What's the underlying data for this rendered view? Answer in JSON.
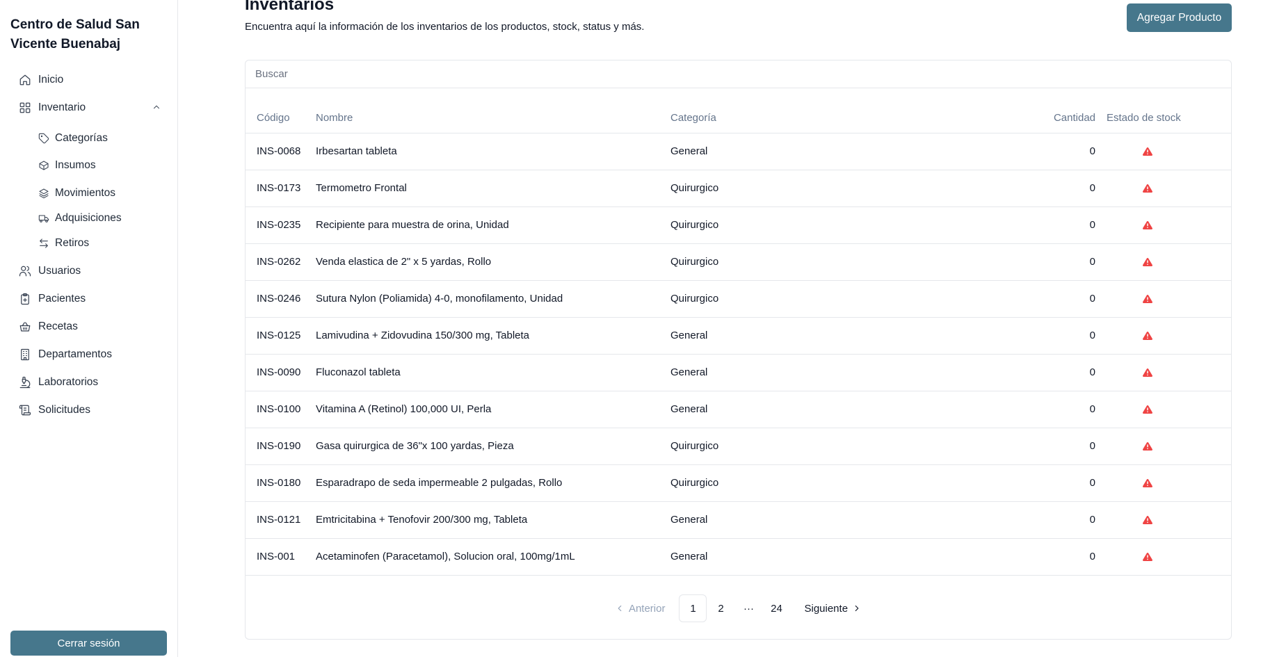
{
  "sidebar": {
    "brand": "Centro de Salud San Vicente Buenabaj",
    "items": [
      {
        "label": "Inicio",
        "icon": "home-icon"
      },
      {
        "label": "Inventario",
        "icon": "grid-icon"
      },
      {
        "label": "Categorías",
        "icon": "tag-icon"
      },
      {
        "label": "Insumos",
        "icon": "box-icon"
      },
      {
        "label": "Movimientos",
        "icon": "layers-icon"
      },
      {
        "label": "Adquisiciones",
        "icon": "truck-icon"
      },
      {
        "label": "Retiros",
        "icon": "arrows-icon"
      },
      {
        "label": "Usuarios",
        "icon": "users-icon"
      },
      {
        "label": "Pacientes",
        "icon": "clipboard-plus-icon"
      },
      {
        "label": "Recetas",
        "icon": "basket-icon"
      },
      {
        "label": "Departamentos",
        "icon": "building-icon"
      },
      {
        "label": "Laboratorios",
        "icon": "microscope-icon"
      },
      {
        "label": "Solicitudes",
        "icon": "scroll-icon"
      }
    ],
    "logout_label": "Cerrar sesión"
  },
  "header": {
    "title": "Inventarios",
    "subtitle": "Encuentra aquí la información de los inventarios de los productos, stock, status y más.",
    "add_button": "Agregar Producto"
  },
  "search": {
    "placeholder": "Buscar",
    "value": ""
  },
  "table": {
    "headers": {
      "code": "Código",
      "name": "Nombre",
      "category": "Categoría",
      "quantity": "Cantidad",
      "status": "Estado de stock"
    },
    "status_color": "#ef4444",
    "rows": [
      {
        "code": "INS-0068",
        "name": "Irbesartan tableta",
        "category": "General",
        "quantity": "0"
      },
      {
        "code": "INS-0173",
        "name": "Termometro Frontal",
        "category": "Quirurgico",
        "quantity": "0"
      },
      {
        "code": "INS-0235",
        "name": "Recipiente para muestra de orina, Unidad",
        "category": "Quirurgico",
        "quantity": "0"
      },
      {
        "code": "INS-0262",
        "name": "Venda elastica de 2\" x 5 yardas, Rollo",
        "category": "Quirurgico",
        "quantity": "0"
      },
      {
        "code": "INS-0246",
        "name": "Sutura Nylon (Poliamida) 4-0, monofilamento, Unidad",
        "category": "Quirurgico",
        "quantity": "0"
      },
      {
        "code": "INS-0125",
        "name": "Lamivudina + Zidovudina 150/300 mg, Tableta",
        "category": "General",
        "quantity": "0"
      },
      {
        "code": "INS-0090",
        "name": "Fluconazol tableta",
        "category": "General",
        "quantity": "0"
      },
      {
        "code": "INS-0100",
        "name": "Vitamina A (Retinol) 100,000 UI, Perla",
        "category": "General",
        "quantity": "0"
      },
      {
        "code": "INS-0190",
        "name": "Gasa quirurgica de 36\"x 100 yardas, Pieza",
        "category": "Quirurgico",
        "quantity": "0"
      },
      {
        "code": "INS-0180",
        "name": "Esparadrapo de seda impermeable 2 pulgadas, Rollo",
        "category": "Quirurgico",
        "quantity": "0"
      },
      {
        "code": "INS-0121",
        "name": "Emtricitabina + Tenofovir 200/300 mg, Tableta",
        "category": "General",
        "quantity": "0"
      },
      {
        "code": "INS-001",
        "name": "Acetaminofen (Paracetamol), Solucion oral, 100mg/1mL",
        "category": "General",
        "quantity": "0"
      }
    ]
  },
  "pagination": {
    "prev": "Anterior",
    "pages": [
      "1",
      "2"
    ],
    "ellipsis": "···",
    "last": "24",
    "next": "Siguiente",
    "current": "1"
  },
  "colors": {
    "accent": "#46778c",
    "warning": "#ef4444"
  }
}
